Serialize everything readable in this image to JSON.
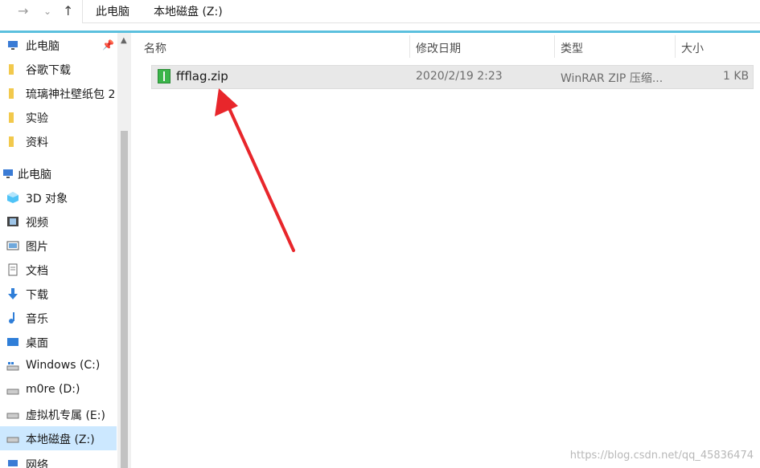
{
  "nav": {
    "back": "←",
    "forward": "→",
    "dropdown": "⌄",
    "up": "↑"
  },
  "breadcrumb": [
    "此电脑",
    "本地磁盘 (Z:)"
  ],
  "sidebar": {
    "quick_access": [
      {
        "label": "此电脑",
        "icon": "computer-icon",
        "pinned": true
      },
      {
        "label": "谷歌下载",
        "icon": "folder-icon"
      },
      {
        "label": "琉璃神社壁纸包 2",
        "icon": "folder-icon"
      },
      {
        "label": "实验",
        "icon": "folder-icon"
      },
      {
        "label": "资料",
        "icon": "folder-icon"
      }
    ],
    "this_pc": {
      "label": "此电脑",
      "icon": "computer-icon"
    },
    "items": [
      {
        "label": "3D 对象",
        "icon": "cube-icon"
      },
      {
        "label": "视频",
        "icon": "video-icon"
      },
      {
        "label": "图片",
        "icon": "picture-icon"
      },
      {
        "label": "文档",
        "icon": "document-icon"
      },
      {
        "label": "下载",
        "icon": "download-icon"
      },
      {
        "label": "音乐",
        "icon": "music-icon"
      },
      {
        "label": "桌面",
        "icon": "desktop-icon"
      },
      {
        "label": "Windows (C:)",
        "icon": "drive-icon"
      },
      {
        "label": "m0re (D:)",
        "icon": "drive-icon"
      },
      {
        "label": "虚拟机专属 (E:)",
        "icon": "drive-icon"
      },
      {
        "label": "本地磁盘 (Z:)",
        "icon": "drive-icon",
        "selected": true
      },
      {
        "label": "网络",
        "icon": "network-icon"
      }
    ]
  },
  "columns": [
    "名称",
    "修改日期",
    "类型",
    "大小"
  ],
  "files": [
    {
      "name": "ffflag.zip",
      "modified": "2020/2/19 2:23",
      "type": "WinRAR ZIP 压缩...",
      "size": "1 KB",
      "icon": "zip-icon"
    }
  ],
  "watermark": "https://blog.csdn.net/qq_45836474",
  "colors": {
    "accent": "#5bc0de",
    "selected": "#cce8ff",
    "annotation_arrow": "#e8262b"
  }
}
